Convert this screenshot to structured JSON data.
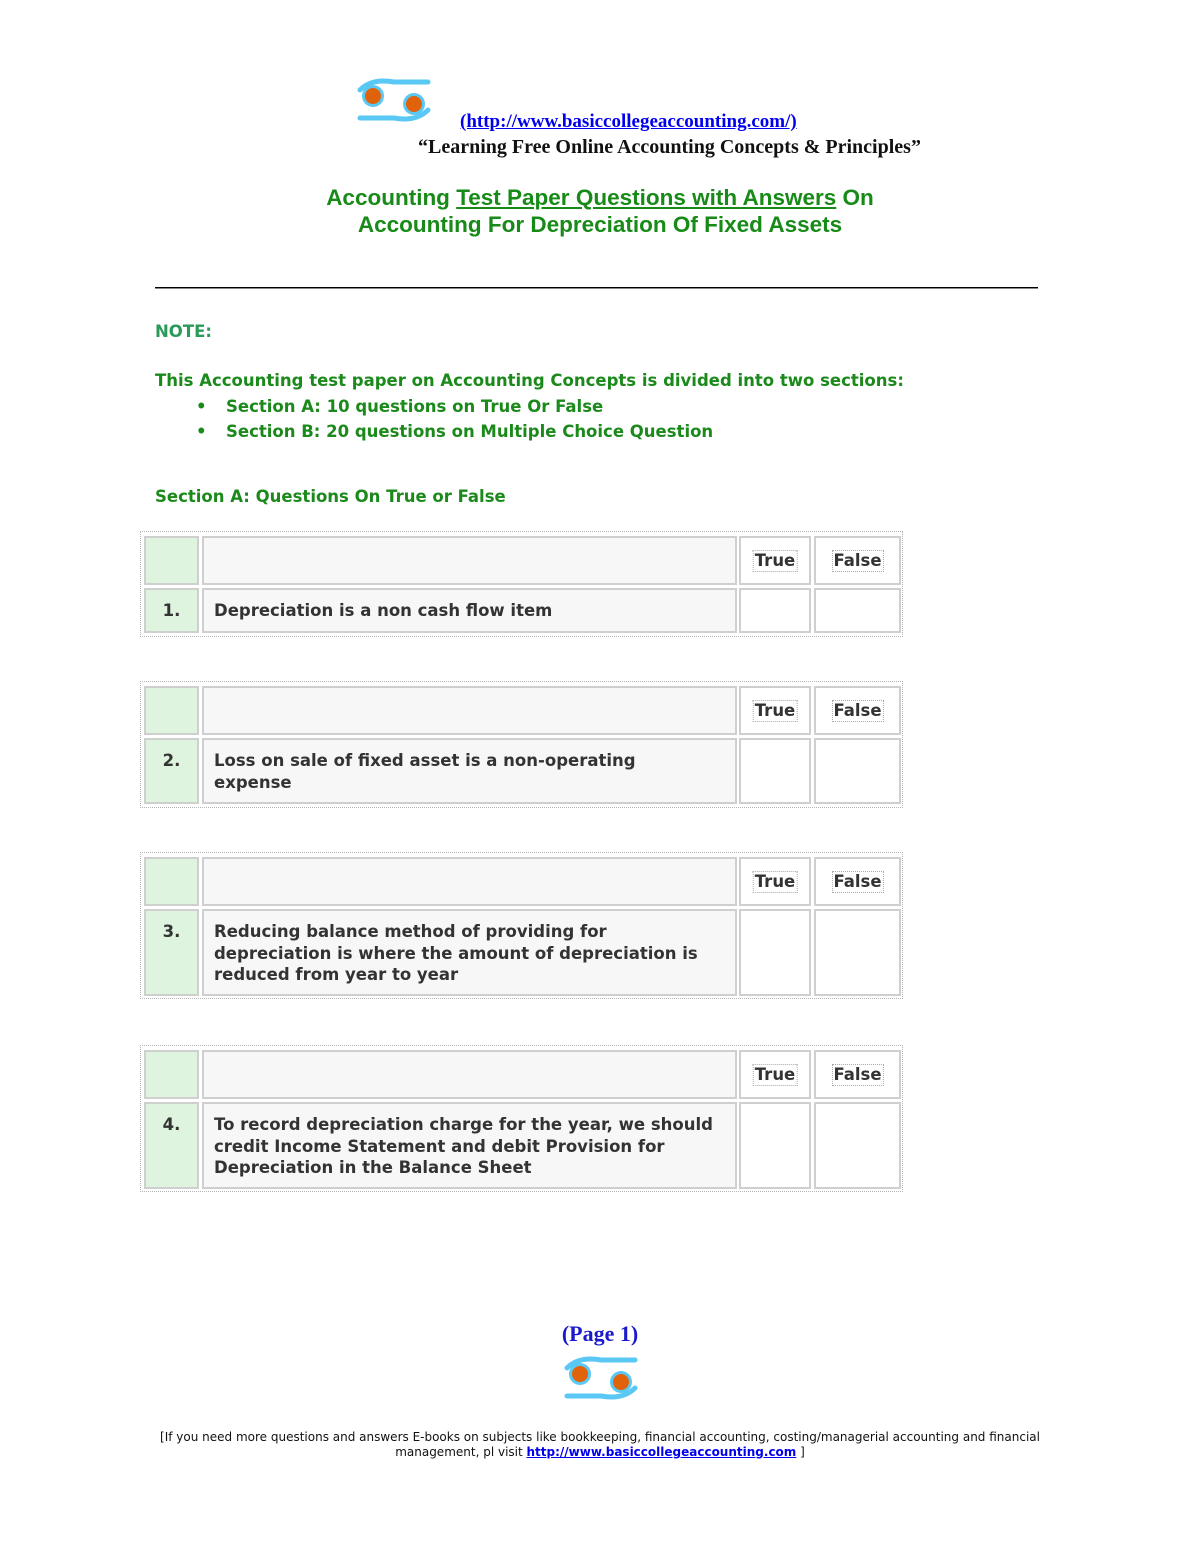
{
  "header": {
    "logo_icon": "cancer-zodiac-logo-icon",
    "site_link": "(http://www.basiccollegeaccounting.com/)",
    "tagline": "“Learning Free Online Accounting Concepts & Principles”"
  },
  "title": {
    "line1_pre": "Accounting ",
    "line1_underlined": "Test Paper Questions with Answers",
    "line1_post": " On",
    "line2": "Accounting For Depreciation Of Fixed Assets"
  },
  "note": {
    "label": "NOTE:",
    "intro": "This Accounting test paper on Accounting Concepts is divided into two sections:",
    "bullet_glyph": "•",
    "bullets": [
      "Section A: 10 questions on True Or  False",
      "Section B: 20 questions on Multiple Choice Question"
    ]
  },
  "section_a": {
    "heading": "Section A:  Questions On True or False",
    "true_label": "True",
    "false_label": "False",
    "questions": [
      {
        "number": "1.",
        "text": "Depreciation is a non cash flow item"
      },
      {
        "number": "2.",
        "text": "Loss on sale of fixed asset is a non-operating expense"
      },
      {
        "number": "3.",
        "text": "Reducing balance method of providing for depreciation is where the amount of depreciation is reduced from year to year"
      },
      {
        "number": "4.",
        "text": "To record depreciation charge for the year, we should credit Income Statement and debit Provision for Depreciation in the Balance Sheet"
      }
    ]
  },
  "footer": {
    "page_label": "(Page 1)",
    "note_pre": "[If you need more questions and answers E-books on subjects like bookkeeping, financial accounting, costing/managerial accounting and financial management, pl visit ",
    "note_link": "http://www.basiccollegeaccounting.com",
    "note_post": " ]"
  },
  "colors": {
    "title_green": "#178a17",
    "note_green": "#2a9a5a",
    "link_blue": "#0000ee",
    "logo_blue": "#5ac8f5",
    "logo_orange": "#e0620a",
    "num_cell_bg": "#dff4df"
  }
}
